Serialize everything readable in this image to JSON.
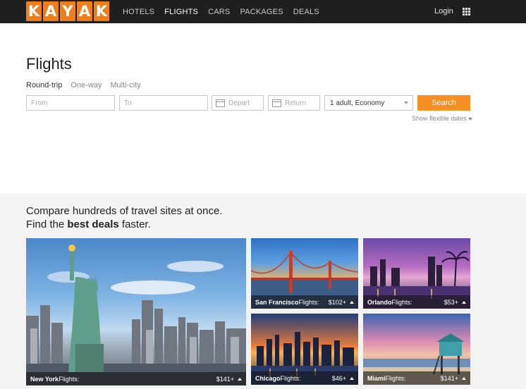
{
  "brand": {
    "logo_letters": [
      "K",
      "A",
      "Y",
      "A",
      "K"
    ],
    "accent_color": "#f07e1b",
    "button_color": "#f68f22"
  },
  "nav": {
    "items": [
      {
        "label": "HOTELS"
      },
      {
        "label": "FLIGHTS"
      },
      {
        "label": "CARS"
      },
      {
        "label": "PACKAGES"
      },
      {
        "label": "DEALS"
      }
    ],
    "active": "FLIGHTS",
    "login_label": "Login",
    "apps_icon": "grid-icon"
  },
  "search": {
    "title": "Flights",
    "trip_types": [
      {
        "label": "Round-trip"
      },
      {
        "label": "One-way"
      },
      {
        "label": "Multi-city"
      }
    ],
    "from_placeholder": "From",
    "to_placeholder": "To",
    "depart_placeholder": "Depart",
    "return_placeholder": "Return",
    "travelers_value": "1 adult, Economy",
    "search_label": "Search",
    "flex_dates_label": "Show flexible dates"
  },
  "deals": {
    "tagline_line1": "Compare hundreds of travel sites at once.",
    "tagline_line2_pre": "Find the ",
    "tagline_line2_bold": "best deals",
    "tagline_line2_post": " faster.",
    "cards": [
      {
        "city": "New York",
        "suffix": " Flights:",
        "price": "$141+"
      },
      {
        "city": "San Francisco",
        "suffix": " Flights:",
        "price": "$102+"
      },
      {
        "city": "Orlando",
        "suffix": " Flights:",
        "price": "$53+"
      },
      {
        "city": "Chicago",
        "suffix": " Flights:",
        "price": "$46+"
      },
      {
        "city": "Miami",
        "suffix": " Flights:",
        "price": "$141+"
      }
    ]
  }
}
